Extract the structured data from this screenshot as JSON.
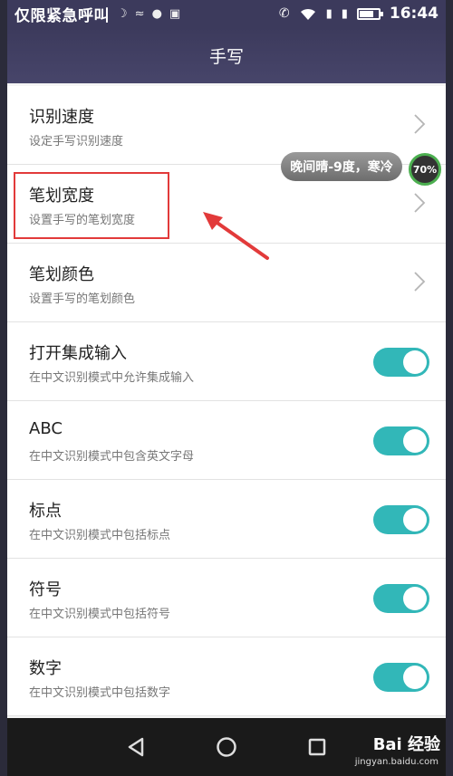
{
  "status_bar": {
    "carrier": "仅限紧急呼叫",
    "time": "16:44",
    "battery_level": 0.7
  },
  "header": {
    "title": "手写"
  },
  "settings": [
    {
      "title": "识别速度",
      "subtitle": "设定手写识别速度",
      "control": "chevron"
    },
    {
      "title": "笔划宽度",
      "subtitle": "设置手写的笔划宽度",
      "control": "chevron"
    },
    {
      "title": "笔划颜色",
      "subtitle": "设置手写的笔划颜色",
      "control": "chevron"
    },
    {
      "title": "打开集成输入",
      "subtitle": "在中文识别模式中允许集成输入",
      "control": "toggle",
      "on": true
    },
    {
      "title": "ABC",
      "subtitle": "在中文识别模式中包含英文字母",
      "control": "toggle",
      "on": true
    },
    {
      "title": "标点",
      "subtitle": "在中文识别模式中包括标点",
      "control": "toggle",
      "on": true
    },
    {
      "title": "符号",
      "subtitle": "在中文识别模式中包括符号",
      "control": "toggle",
      "on": true
    },
    {
      "title": "数字",
      "subtitle": "在中文识别模式中包括数字",
      "control": "toggle",
      "on": true
    }
  ],
  "overlay": {
    "weather": "晚间晴-9度，寒冷",
    "memory": "70%"
  },
  "watermark": {
    "brand": "Bai 经验",
    "url": "jingyan.baidu.com"
  },
  "colors": {
    "header": "#3c3a5c",
    "toggle_on": "#32b7b8",
    "highlight": "#e23a3a"
  }
}
